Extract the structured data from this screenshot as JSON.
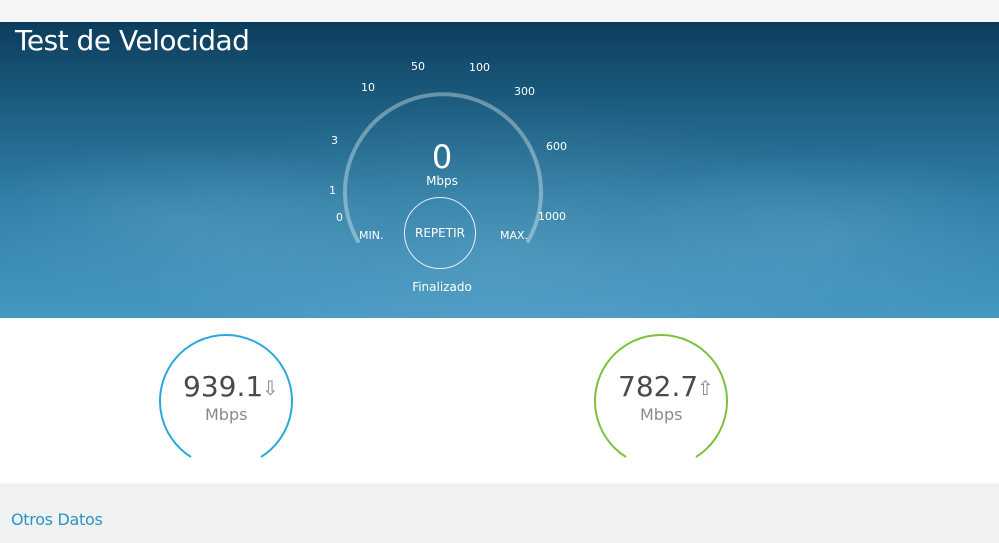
{
  "header": {
    "title": "Test de Velocidad"
  },
  "gauge": {
    "ticks": [
      "0",
      "1",
      "3",
      "10",
      "50",
      "100",
      "300",
      "600",
      "1000"
    ],
    "speed_value": "0",
    "speed_unit": "Mbps",
    "min_label": "MIN.",
    "max_label": "MAX.",
    "repeat_label": "REPETIR",
    "status": "Finalizado"
  },
  "download": {
    "value": "939.1",
    "unit": "Mbps",
    "arrow_icon": "download-arrow-icon",
    "color": "#29a9d6"
  },
  "upload": {
    "value": "782.7",
    "unit": "Mbps",
    "arrow_icon": "upload-arrow-icon",
    "color": "#7cc13a"
  },
  "others": {
    "title": "Otros Datos"
  },
  "colors": {
    "hero_dark": "#0d3d5c",
    "hero_light": "#4598c2",
    "accent_blue": "#2a94c4"
  }
}
